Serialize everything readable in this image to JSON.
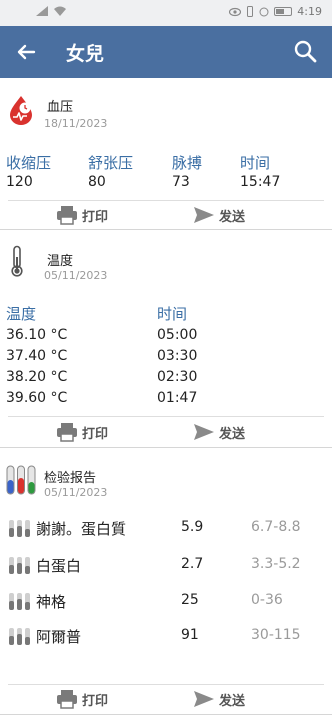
{
  "status_bar": {
    "time": "4:19"
  },
  "app_bar": {
    "title": "女兒"
  },
  "blood_pressure": {
    "title": "血压",
    "date": "18/11/2023",
    "labels": [
      "收缩压",
      "舒张压",
      "脉搏",
      "时间"
    ],
    "values": [
      "120",
      "80",
      "73",
      "15:47"
    ]
  },
  "temperature": {
    "title": "温度",
    "date": "05/11/2023",
    "col_temp": "温度",
    "col_time": "时间",
    "rows": [
      {
        "temp": "36.10 °C",
        "time": "05:00"
      },
      {
        "temp": "37.40 °C",
        "time": "03:30"
      },
      {
        "temp": "38.20 °C",
        "time": "02:30"
      },
      {
        "temp": "39.60 °C",
        "time": "01:47"
      }
    ]
  },
  "lab_report": {
    "title": "检验报告",
    "date": "05/11/2023",
    "rows": [
      {
        "name": "謝謝。蛋白質",
        "value": "5.9",
        "range": "6.7-8.8"
      },
      {
        "name": "白蛋白",
        "value": "2.7",
        "range": "3.3-5.2"
      },
      {
        "name": "神格",
        "value": "25",
        "range": "0-36"
      },
      {
        "name": "阿爾普",
        "value": "91",
        "range": "30-115"
      }
    ]
  },
  "actions": {
    "print": "打印",
    "send": "发送"
  },
  "icons": {
    "back": "arrow-left-icon",
    "search": "search-icon",
    "blood_pressure": "blood-drop-icon",
    "temperature": "thermometer-icon",
    "lab": "test-tubes-icon",
    "print": "printer-icon",
    "send": "send-icon"
  },
  "colors": {
    "app_bar": "#4a6fa0",
    "label_blue": "#3a6ea5",
    "blood_red": "#d9322e",
    "range_grey": "#9a9a9a"
  }
}
